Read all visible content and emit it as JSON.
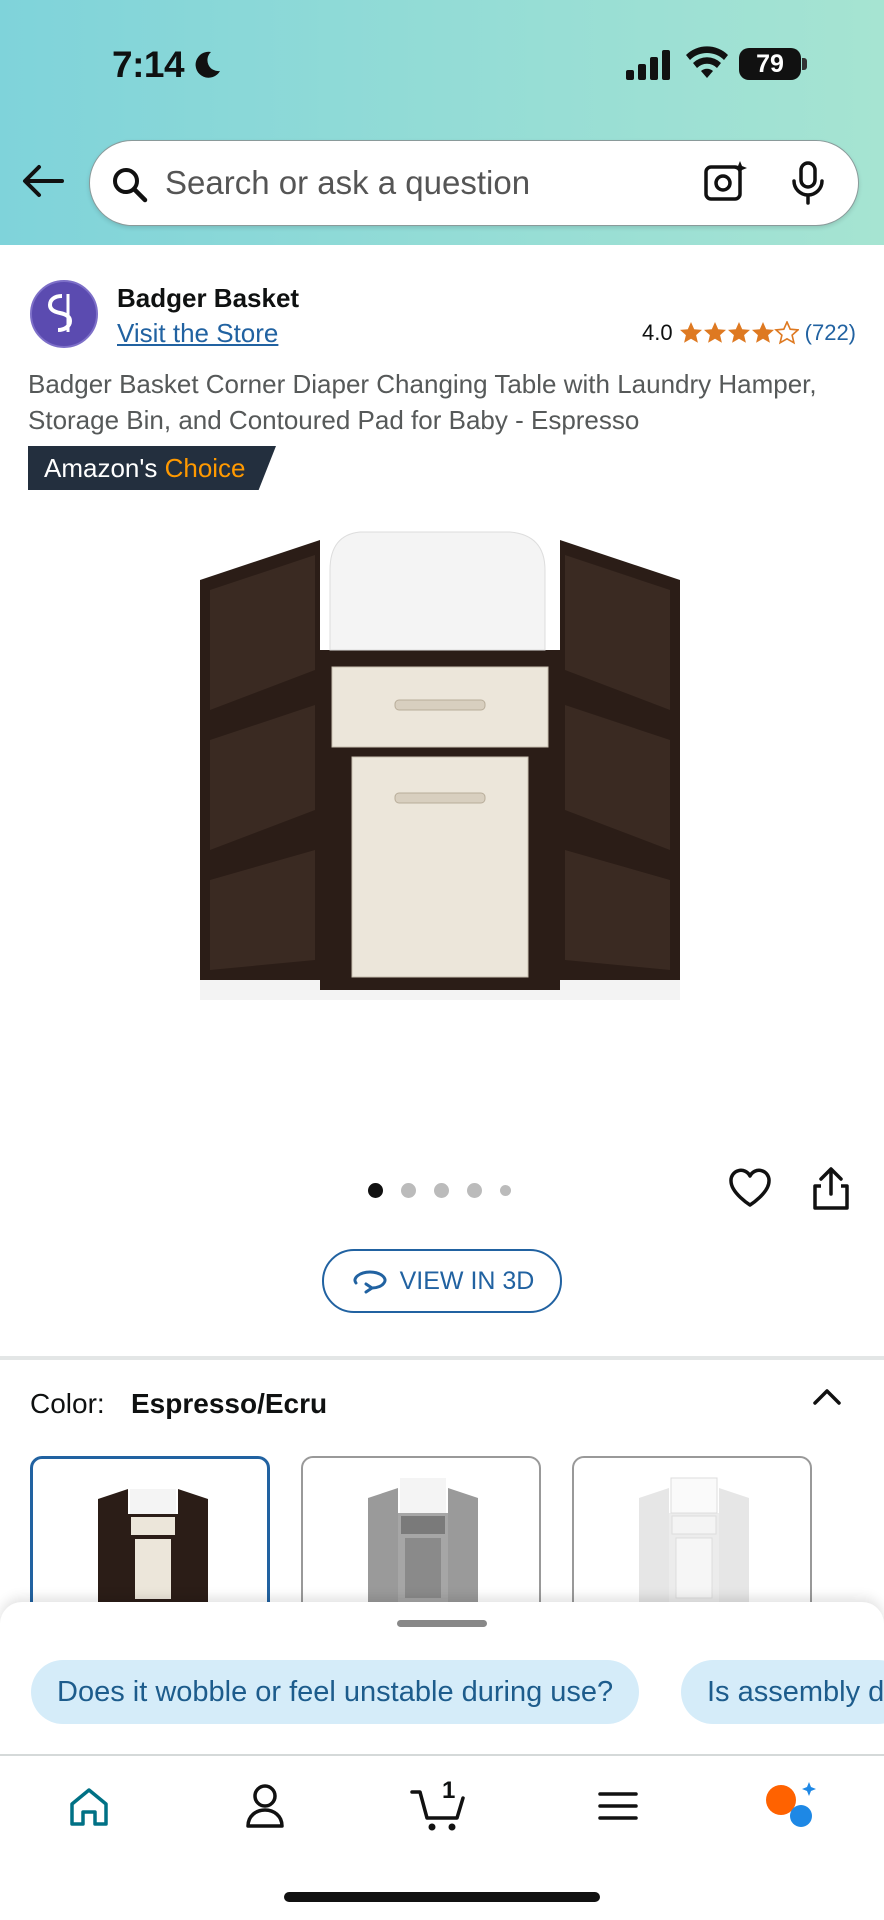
{
  "status_bar": {
    "time": "7:14",
    "battery": "79"
  },
  "search": {
    "placeholder": "Search or ask a question"
  },
  "seller": {
    "brand": "Badger Basket",
    "visit_store": "Visit the Store"
  },
  "rating": {
    "value": "4.0",
    "stars": 4,
    "count": "(722)"
  },
  "product": {
    "title": "Badger Basket Corner Diaper Changing Table with Laundry Hamper, Storage Bin, and Contoured Pad for Baby - Espresso"
  },
  "badge": {
    "prefix": "Amazon's",
    "highlight": "Choice"
  },
  "carousel": {
    "total_images": 5,
    "active_index": 0
  },
  "view_3d": {
    "label": "VIEW IN 3D"
  },
  "color": {
    "label": "Color:",
    "selected": "Espresso/Ecru",
    "swatches": [
      "Espresso/Ecru",
      "Gray",
      "White"
    ]
  },
  "questions": [
    "Does it wobble or feel unstable during use?",
    "Is assembly d"
  ],
  "cart": {
    "count": "1"
  },
  "tabs": [
    "home-icon",
    "account-icon",
    "cart-icon",
    "menu-icon",
    "rufus-icon"
  ],
  "colors": {
    "accent": "#2162a1",
    "star": "#de7921",
    "espresso": "#2b1d17",
    "badge_bg": "#232f3e",
    "choice": "#ff9900"
  }
}
